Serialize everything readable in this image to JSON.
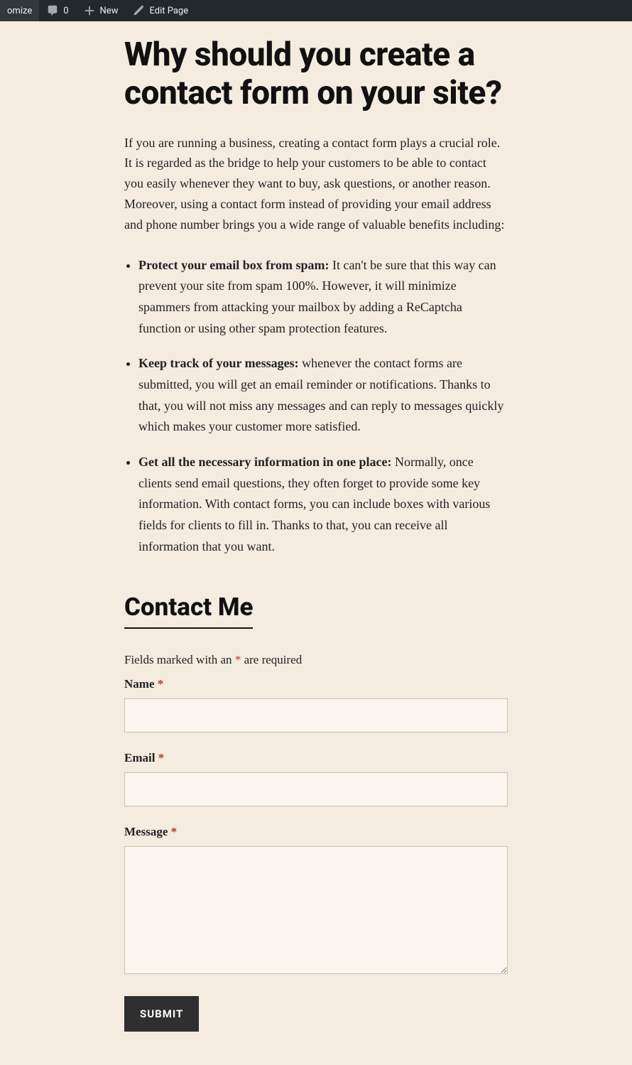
{
  "adminbar": {
    "customize": "omize",
    "comments_count": "0",
    "new": "New",
    "edit_page": "Edit Page"
  },
  "article": {
    "heading": "Why should you create a contact form on your site?",
    "intro": "If you are running a business, creating a contact form plays a crucial role. It is regarded as the bridge to help your customers to be able to contact you easily whenever they want to buy, ask questions, or another reason. Moreover, using a contact form instead of providing your email address and phone number brings you a wide range of valuable benefits including:",
    "benefits": [
      {
        "title": "Protect your email box from spam:",
        "text": " It can't be sure that this way can prevent your site from spam 100%. However, it will minimize spammers from attacking your mailbox by adding a ReCaptcha function or using other spam protection features."
      },
      {
        "title": "Keep track of your messages:",
        "text": " whenever the contact forms are submitted, you will get an email reminder or notifications. Thanks to that, you will not miss any messages and can reply to messages quickly which makes your customer more satisfied."
      },
      {
        "title": "Get all the necessary information in one place:",
        "text": " Normally, once clients send email questions, they often forget to provide some key information. With contact forms, you can include boxes with various fields for clients to fill in. Thanks to that, you can receive all information that you want."
      }
    ]
  },
  "form": {
    "heading": "Contact Me",
    "required_note_before": "Fields marked with an ",
    "asterisk": "*",
    "required_note_after": " are required",
    "name_label": "Name ",
    "email_label": "Email ",
    "message_label": "Message ",
    "submit_label": "SUBMIT"
  }
}
